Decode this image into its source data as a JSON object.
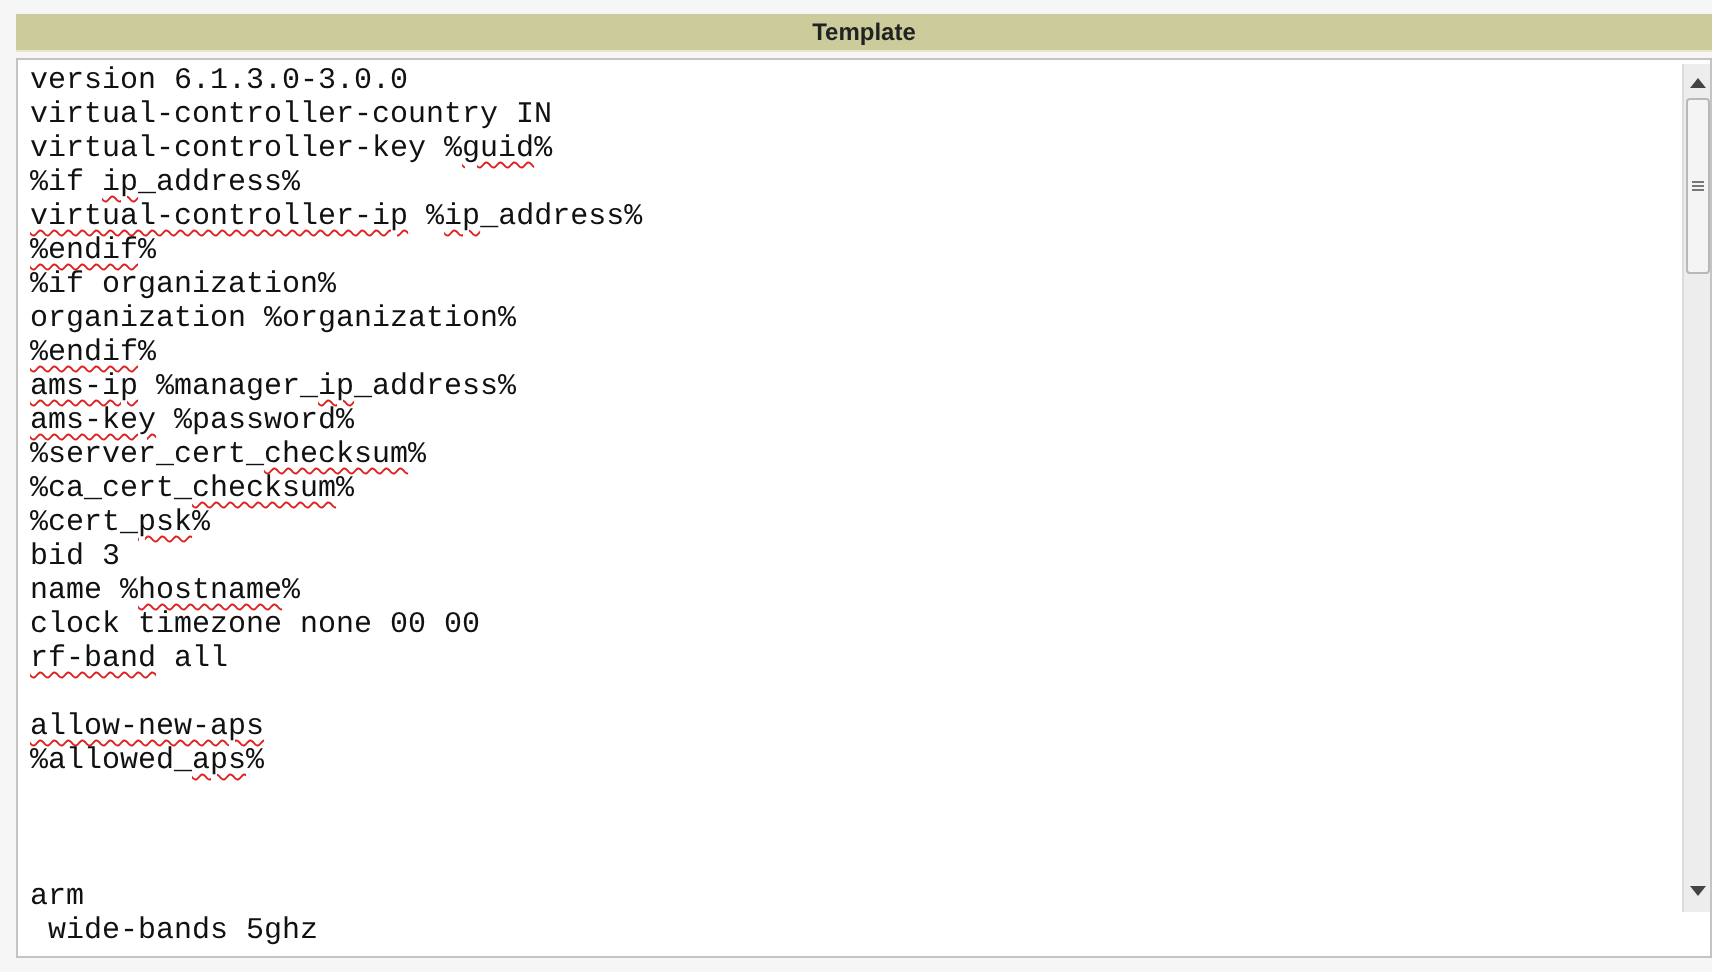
{
  "panel": {
    "title": "Template"
  },
  "lines": [
    {
      "kind": "text",
      "segments": [
        {
          "text": "version 6.1.3.0-3.0.0",
          "misspelled": false
        }
      ]
    },
    {
      "kind": "text",
      "segments": [
        {
          "text": "virtual-controller-country IN",
          "misspelled": false
        }
      ]
    },
    {
      "kind": "text",
      "segments": [
        {
          "text": "virtual-controller-key %",
          "misspelled": false
        },
        {
          "text": "guid",
          "misspelled": true
        },
        {
          "text": "%",
          "misspelled": false
        }
      ]
    },
    {
      "kind": "text",
      "segments": [
        {
          "text": "%if ",
          "misspelled": false
        },
        {
          "text": "ip",
          "misspelled": true
        },
        {
          "text": "_address%",
          "misspelled": false
        }
      ]
    },
    {
      "kind": "text",
      "segments": [
        {
          "text": "virtual-controller-ip",
          "misspelled": true
        },
        {
          "text": " %",
          "misspelled": false
        },
        {
          "text": "ip",
          "misspelled": true
        },
        {
          "text": "_address%",
          "misspelled": false
        }
      ]
    },
    {
      "kind": "text",
      "segments": [
        {
          "text": "%endif",
          "misspelled": true
        },
        {
          "text": "%",
          "misspelled": false
        }
      ]
    },
    {
      "kind": "text",
      "segments": [
        {
          "text": "%if organization%",
          "misspelled": false
        }
      ]
    },
    {
      "kind": "text",
      "segments": [
        {
          "text": "organization %organization%",
          "misspelled": false
        }
      ]
    },
    {
      "kind": "text",
      "segments": [
        {
          "text": "%endif",
          "misspelled": true
        },
        {
          "text": "%",
          "misspelled": false
        }
      ]
    },
    {
      "kind": "text",
      "segments": [
        {
          "text": "ams-ip",
          "misspelled": true
        },
        {
          "text": " %manager_",
          "misspelled": false
        },
        {
          "text": "ip",
          "misspelled": true
        },
        {
          "text": "_address%",
          "misspelled": false
        }
      ]
    },
    {
      "kind": "text",
      "segments": [
        {
          "text": "ams-key",
          "misspelled": true
        },
        {
          "text": " %password%",
          "misspelled": false
        }
      ]
    },
    {
      "kind": "text",
      "segments": [
        {
          "text": "%server_cert_",
          "misspelled": false
        },
        {
          "text": "checksum",
          "misspelled": true
        },
        {
          "text": "%",
          "misspelled": false
        }
      ]
    },
    {
      "kind": "text",
      "segments": [
        {
          "text": "%ca_cert_",
          "misspelled": false
        },
        {
          "text": "checksum",
          "misspelled": true
        },
        {
          "text": "%",
          "misspelled": false
        }
      ]
    },
    {
      "kind": "text",
      "segments": [
        {
          "text": "%cert_",
          "misspelled": false
        },
        {
          "text": "psk",
          "misspelled": true
        },
        {
          "text": "%",
          "misspelled": false
        }
      ]
    },
    {
      "kind": "text",
      "segments": [
        {
          "text": "bid 3",
          "misspelled": false
        }
      ]
    },
    {
      "kind": "text",
      "segments": [
        {
          "text": "name %",
          "misspelled": false
        },
        {
          "text": "hostname",
          "misspelled": true
        },
        {
          "text": "%",
          "misspelled": false
        }
      ]
    },
    {
      "kind": "text",
      "segments": [
        {
          "text": "clock timezone none 00 00",
          "misspelled": false
        }
      ]
    },
    {
      "kind": "text",
      "segments": [
        {
          "text": "rf-band",
          "misspelled": true
        },
        {
          "text": " all",
          "misspelled": false
        }
      ]
    },
    {
      "kind": "blank"
    },
    {
      "kind": "text",
      "segments": [
        {
          "text": "allow-new-aps",
          "misspelled": true
        }
      ]
    },
    {
      "kind": "text",
      "segments": [
        {
          "text": "%allowed_",
          "misspelled": false
        },
        {
          "text": "aps",
          "misspelled": true
        },
        {
          "text": "%",
          "misspelled": false
        }
      ]
    },
    {
      "kind": "blank"
    },
    {
      "kind": "blank"
    },
    {
      "kind": "blank"
    },
    {
      "kind": "text",
      "segments": [
        {
          "text": "arm",
          "misspelled": false
        }
      ]
    },
    {
      "kind": "text",
      "segments": [
        {
          "text": " wide-bands 5ghz",
          "misspelled": false
        }
      ]
    }
  ]
}
